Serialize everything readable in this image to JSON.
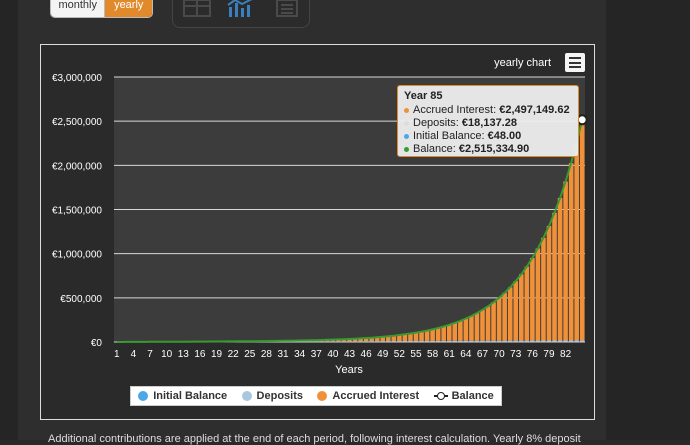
{
  "toggle": {
    "monthly_label": "monthly",
    "yearly_label": "yearly",
    "selected": "yearly"
  },
  "colors": {
    "accent": "#e08a2c",
    "accrued": "#f0913a",
    "deposits": "#a8c8e0",
    "initial": "#4aa8e8",
    "balance_line": "#3a9a30",
    "plot_bg": "#3c3c3c"
  },
  "icons": {
    "table": "table-view-icon",
    "chart": "bar-chart-icon",
    "list": "list-view-icon",
    "menu": "hamburger-menu-icon"
  },
  "chart_data": {
    "type": "bar",
    "title": "yearly chart",
    "xlabel": "Years",
    "ylabel": "",
    "x_start": 1,
    "x_end": 85,
    "xtick_labels": [
      "1",
      "4",
      "7",
      "10",
      "13",
      "16",
      "19",
      "22",
      "25",
      "28",
      "31",
      "34",
      "37",
      "40",
      "43",
      "46",
      "49",
      "52",
      "55",
      "58",
      "61",
      "64",
      "67",
      "70",
      "73",
      "76",
      "79",
      "82"
    ],
    "ylim": [
      0,
      3000000
    ],
    "ytick_labels": [
      "€3,000,000",
      "€2,500,000",
      "€2,000,000",
      "€1,500,000",
      "€1,000,000",
      "€500,000",
      "€0"
    ],
    "grid": true,
    "legend_position": "bottom",
    "series": [
      {
        "name": "Initial Balance",
        "color": "#4aa8e8",
        "start_value": 48,
        "end_value": 48
      },
      {
        "name": "Deposits",
        "color": "#a8c8e0",
        "start_value": 213.38,
        "end_value": 18137.28
      },
      {
        "name": "Accrued Interest",
        "color": "#f0913a",
        "start_value": 0,
        "end_value": 2497149.62
      },
      {
        "name": "Balance",
        "color": "#3a9a30",
        "start_value": 261.38,
        "end_value": 2515334.9
      }
    ],
    "tooltip": {
      "title": "Year 85",
      "rows": [
        {
          "label": "Accrued Interest:",
          "value": "€2,497,149.62",
          "color": "#f0913a"
        },
        {
          "label": "Deposits:",
          "value": "€18,137.28",
          "color": "#dddddd"
        },
        {
          "label": "Initial Balance:",
          "value": "€48.00",
          "color": "#4aa8e8"
        },
        {
          "label": "Balance:",
          "value": "€2,515,334.90",
          "color": "#3a9a30"
        }
      ]
    }
  },
  "footnote": "Additional contributions are applied at the end of each period, following interest calculation. Yearly 8% deposit"
}
